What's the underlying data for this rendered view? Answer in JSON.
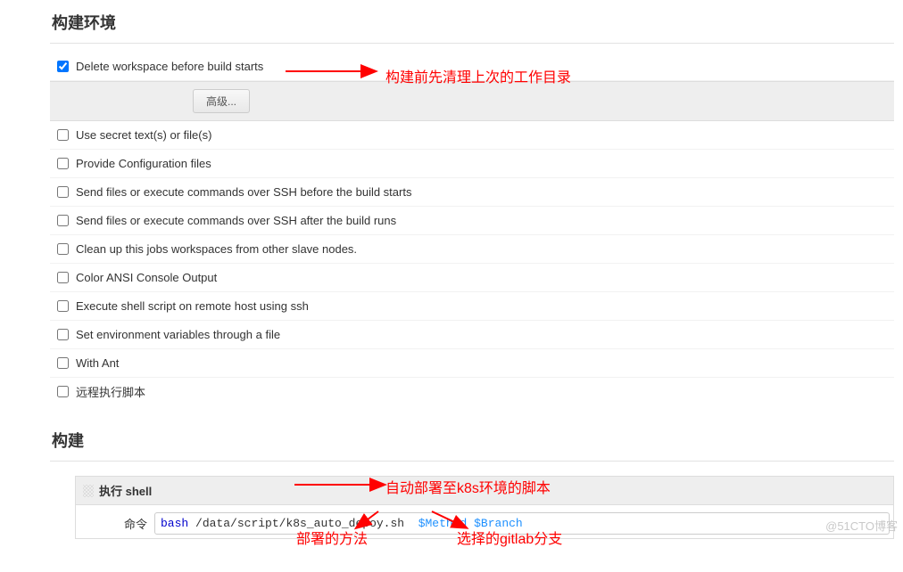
{
  "build_env": {
    "title": "构建环境",
    "advanced_button": "高级...",
    "options": [
      {
        "label": "Delete workspace before build starts",
        "checked": true
      },
      {
        "label": "Use secret text(s) or file(s)",
        "checked": false
      },
      {
        "label": "Provide Configuration files",
        "checked": false
      },
      {
        "label": "Send files or execute commands over SSH before the build starts",
        "checked": false
      },
      {
        "label": "Send files or execute commands over SSH after the build runs",
        "checked": false
      },
      {
        "label": "Clean up this jobs workspaces from other slave nodes.",
        "checked": false
      },
      {
        "label": "Color ANSI Console Output",
        "checked": false
      },
      {
        "label": "Execute shell script on remote host using ssh",
        "checked": false
      },
      {
        "label": "Set environment variables through a file",
        "checked": false
      },
      {
        "label": "With Ant",
        "checked": false
      },
      {
        "label": "远程执行脚本",
        "checked": false
      }
    ]
  },
  "build": {
    "title": "构建",
    "step_header": "执行 shell",
    "cmd_label": "命令",
    "command": {
      "keyword": "bash",
      "path": "/data/script/k8s_auto_depoy.sh",
      "arg1": "$Method",
      "arg2": "$Branch"
    }
  },
  "annotations": {
    "a1": "构建前先清理上次的工作目录",
    "a2": "自动部署至k8s环境的脚本",
    "a3": "部署的方法",
    "a4": "选择的gitlab分支"
  },
  "watermark": "@51CTO博客"
}
